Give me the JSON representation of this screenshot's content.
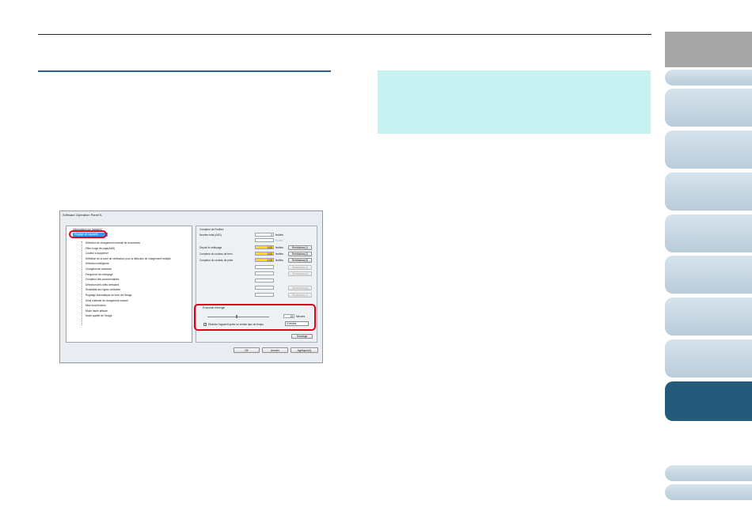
{
  "window": {
    "title": "Software Operation Panel fi-"
  },
  "tree": {
    "root_label": "Informations sur l'appareil",
    "selected": "Réglage de l'appareil",
    "items": [
      "Détection de chargement excessif de documents",
      "Filtre rouge de page(AAD)",
      "Couleur à supprimer",
      "Définition de la zone de vérification pour la détection de chargement multiple",
      "Détection intelligente",
      "Chargements autorisés",
      "Fréquence de nettoyage",
      "Compteur des consommables",
      "Détection des côtés verticales",
      "Sensibilité aux lignes verticales",
      "Rognage automatique du bord de l'image",
      "Délai d'attente de chargement manuel",
      "Mise sous tension",
      "Mode haute altitude",
      "Mode qualité de l'image"
    ]
  },
  "counters": {
    "group_title": "Compteur de Feuilles",
    "rows": [
      {
        "label": "Nombre total (AAD)",
        "value": "0",
        "unit": "feuilles",
        "highlight": false,
        "button": ""
      },
      {
        "label": "",
        "value": "",
        "unit": "feuilles",
        "highlight": false,
        "button": ""
      },
      {
        "label": "Depuis le nettoyage",
        "value": "0,00",
        "unit": "feuilles",
        "highlight": true,
        "button": "Réinitialiser(1)"
      },
      {
        "label": "Compteur du rouleau de frein",
        "value": "0,00",
        "unit": "feuilles",
        "highlight": true,
        "button": "Réinitialiser(2)"
      },
      {
        "label": "Compteur du rouleau de prise",
        "value": "1,00",
        "unit": "feuilles",
        "highlight": true,
        "button": "Réinitialiser(3)"
      }
    ],
    "disabled_buttons": [
      "Réinitialiser(4)",
      "Réinitialiser(5)",
      "Réinitialiser(6)",
      "Réinitialiser(7)"
    ]
  },
  "eco": {
    "group_title": "Économie d'énergie",
    "slider_value": "15",
    "slider_unit": "Minutes",
    "checkbox_label": "Éteindre l'appareil après un certain laps de temps",
    "checkbox_checked": "✓",
    "select_value": "4 heures"
  },
  "buttons": {
    "desktop": "Décalage",
    "ok": "OK",
    "cancel": "Annuler",
    "apply": "Appliquer(A)"
  },
  "colors": {
    "accent": "#245b7b",
    "note_bg": "#c8f2f1",
    "highlight_oval": "#e0001a",
    "counter_highlight": "#ffde00"
  }
}
